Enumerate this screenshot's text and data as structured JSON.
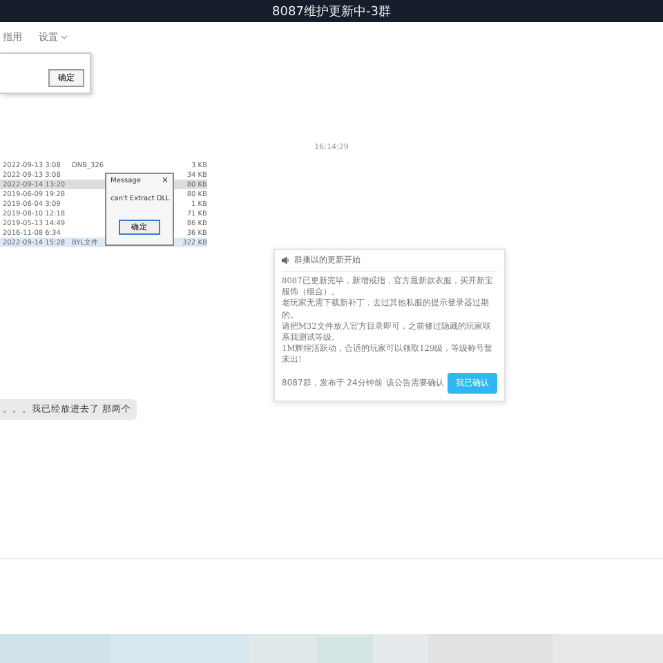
{
  "window": {
    "title": "8087维护更新中-3群"
  },
  "menu": [
    {
      "label": "指用",
      "dropdown": false
    },
    {
      "label": "设置",
      "dropdown": true
    }
  ],
  "top_dialog": {
    "button": "确定"
  },
  "timestamp": "16:14:29",
  "shared_image": {
    "files": [
      {
        "date": "2022-09-13 3:08",
        "name": "DNB_326",
        "size": "3 KB",
        "selected": false,
        "focused": false
      },
      {
        "date": "2022-09-13 3:08",
        "size": "34 KB",
        "selected": false,
        "focused": false
      },
      {
        "date": "2022-09-14 13:20",
        "size": "80 KB",
        "selected": true,
        "focused": false
      },
      {
        "date": "2019-06-09 19:28",
        "size": "80 KB",
        "selected": false,
        "focused": false
      },
      {
        "date": "2019-06-04 3:09",
        "size": "1 KB",
        "selected": false,
        "focused": false
      },
      {
        "date": "2019-08-10 12:18",
        "size": "71 KB",
        "selected": false,
        "focused": false
      },
      {
        "date": "2019-05-13 14:49",
        "size": "86 KB",
        "selected": false,
        "focused": false
      },
      {
        "date": "2016-11-08 6:34",
        "size": "36 KB",
        "selected": false,
        "focused": false
      },
      {
        "date": "2022-09-14 15:28",
        "name": "BYL文件",
        "size": "322 KB",
        "selected": false,
        "focused": true
      }
    ],
    "message_box": {
      "title": "Message",
      "close": "×",
      "text": "can't Extract DLL",
      "button": "确定"
    }
  },
  "message": {
    "text": "。。。我已经放进去了 那两个"
  },
  "announcement": {
    "header": "群播以的更新开始",
    "body": [
      "8087已更新完毕，新增戒指，官方最新款衣服，买开新宝服饰（组合）。",
      "老玩家无需下载新补丁，去过其他私服的提示登录器过期的。",
      "请把M32文件放入官方目录即可，之前修过隐藏的玩家联系我测试等级。",
      "1M辉煌活跃动，合适的玩家可以领取129级，等级称号暂未出!"
    ],
    "meta": "8087群，发布于 24分钟前",
    "notice": "该公告需要确认",
    "button": "我已确认"
  }
}
